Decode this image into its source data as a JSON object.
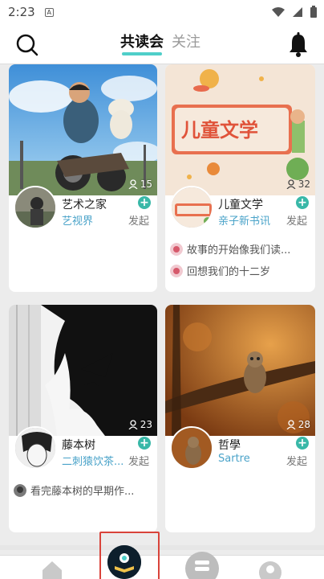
{
  "status_bar": {
    "time": "2:23",
    "sim_label": "A"
  },
  "header": {
    "tabs": [
      {
        "label": "共读会",
        "active": true
      },
      {
        "label": "关注",
        "active": false
      }
    ]
  },
  "cards": [
    {
      "count": "15",
      "name": "艺术之家",
      "subtitle": "艺视界",
      "action": "发起",
      "posts": []
    },
    {
      "count": "32",
      "name": "儿童文学",
      "subtitle": "亲子新书讯",
      "action": "发起",
      "cover_text": "儿童文学",
      "posts": [
        "故事的开始像我们读...",
        "回想我们的十二岁"
      ]
    },
    {
      "count": "23",
      "name": "藤本树",
      "subtitle": "二刺猿饮茶...",
      "action": "发起",
      "posts": [
        "看完藤本树的早期作..."
      ]
    },
    {
      "count": "28",
      "name": "哲學",
      "subtitle": "Sartre",
      "action": "发起",
      "posts": []
    }
  ],
  "colors": {
    "accent": "#4fcfc9",
    "plus": "#39b8a8",
    "link": "#4aa3c9",
    "highlight": "#d9433a"
  }
}
